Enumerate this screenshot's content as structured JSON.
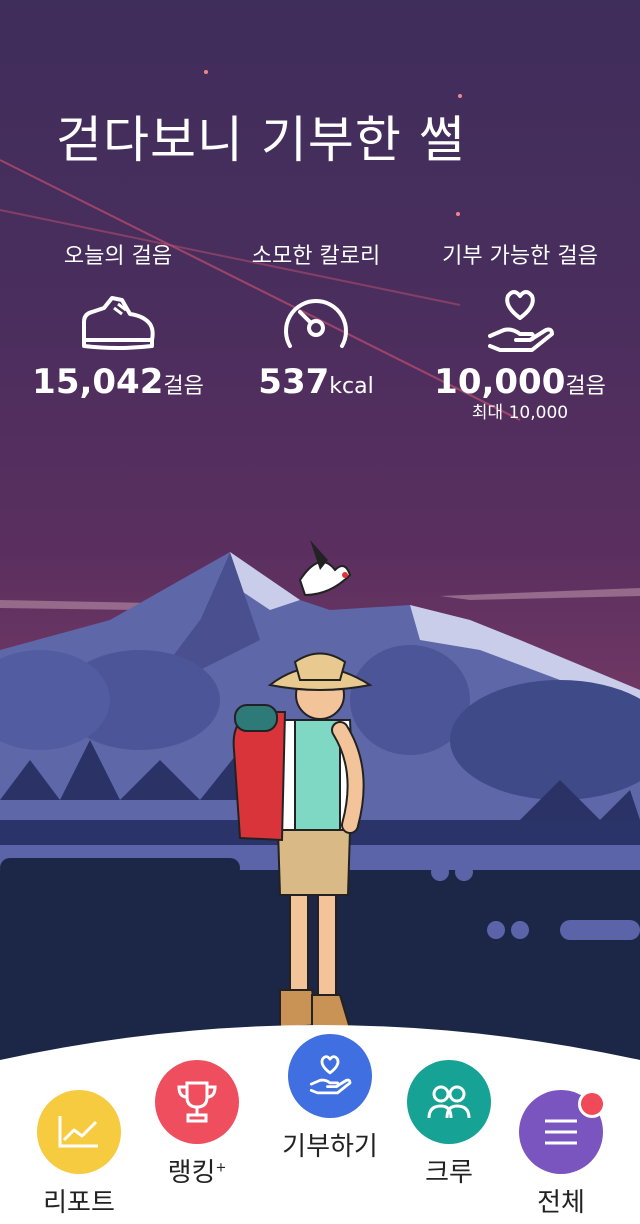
{
  "header": {
    "title": "걷다보니 기부한 썰"
  },
  "stats": {
    "steps": {
      "label": "오늘의 걸음",
      "value": "15,042",
      "unit": "걸음",
      "icon": "sneaker-icon"
    },
    "calories": {
      "label": "소모한 칼로리",
      "value": "537",
      "unit": "kcal",
      "icon": "gauge-icon"
    },
    "donate": {
      "label": "기부 가능한 걸음",
      "value": "10,000",
      "unit": "걸음",
      "sub": "최대 10,000",
      "icon": "heart-hand-icon"
    }
  },
  "nav": {
    "report": {
      "label": "리포트",
      "color": "#f7cb3f",
      "icon": "line-chart-icon"
    },
    "ranking": {
      "label": "랭킹",
      "sup": "+",
      "color": "#ee4e5e",
      "icon": "trophy-icon"
    },
    "donate": {
      "label": "기부하기",
      "color": "#3f6fe0",
      "icon": "heart-hand-icon"
    },
    "crew": {
      "label": "크루",
      "color": "#16a294",
      "icon": "people-icon"
    },
    "all": {
      "label": "전체",
      "color": "#7a55c0",
      "icon": "menu-icon",
      "has_badge": true
    }
  }
}
